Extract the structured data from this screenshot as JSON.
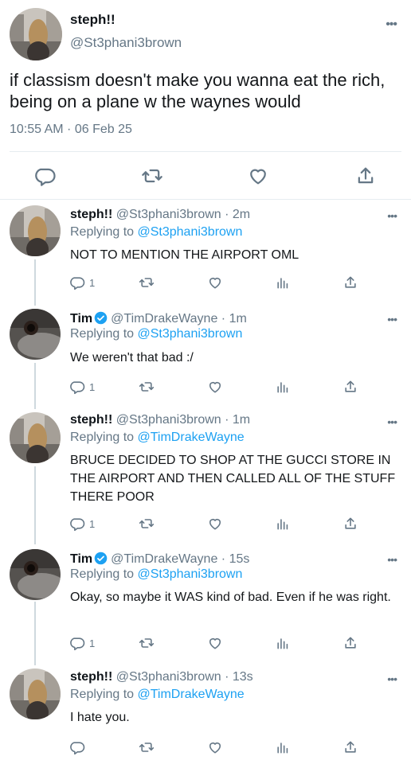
{
  "main_tweet": {
    "display_name": "steph!!",
    "handle": "@St3phani3brown",
    "text": "if classism doesn't make you wanna eat the rich, being on a plane w the waynes would",
    "timestamp": "10:55 AM · 06 Feb 25",
    "more_label": "•••"
  },
  "replies": [
    {
      "display_name": "steph!!",
      "handle_meta": "@St3phani3brown · 2m",
      "replying_prefix": "Replying to ",
      "replying_to": "@St3phani3brown",
      "text": "NOT TO MENTION THE AIRPORT OML",
      "reply_count": "1",
      "more_label": "•••"
    },
    {
      "display_name": "Tim",
      "verified": true,
      "handle_meta": "@TimDrakeWayne · 1m",
      "replying_prefix": "Replying to ",
      "replying_to": "@St3phani3brown",
      "text": "We weren't that bad :/",
      "reply_count": "1",
      "more_label": "•••"
    },
    {
      "display_name": "steph!!",
      "handle_meta": "@St3phani3brown · 1m",
      "replying_prefix": "Replying to ",
      "replying_to": "@TimDrakeWayne",
      "text": "BRUCE DECIDED TO SHOP AT THE GUCCI STORE IN THE AIRPORT AND THEN CALLED ALL OF THE STUFF THERE POOR",
      "reply_count": "1",
      "more_label": "•••"
    },
    {
      "display_name": "Tim",
      "verified": true,
      "handle_meta": "@TimDrakeWayne · 15s",
      "replying_prefix": "Replying to ",
      "replying_to": "@St3phani3brown",
      "text": "Okay, so maybe it WAS kind of bad. Even if he was right.",
      "reply_count": "1",
      "more_label": "•••"
    },
    {
      "display_name": "steph!!",
      "handle_meta": "@St3phani3brown · 13s",
      "replying_prefix": "Replying to ",
      "replying_to": "@TimDrakeWayne",
      "text": "I hate you.",
      "reply_count": "",
      "more_label": "•••"
    }
  ],
  "icons": {
    "reply": "reply-icon",
    "retweet": "retweet-icon",
    "like": "heart-icon",
    "analytics": "analytics-icon",
    "share": "share-icon",
    "verified": "verified-badge-icon",
    "more": "more-icon"
  },
  "colors": {
    "link": "#1da1f2",
    "secondary_text": "#657786",
    "verified": "#1da1f2",
    "thread_line": "#cfd9de"
  }
}
